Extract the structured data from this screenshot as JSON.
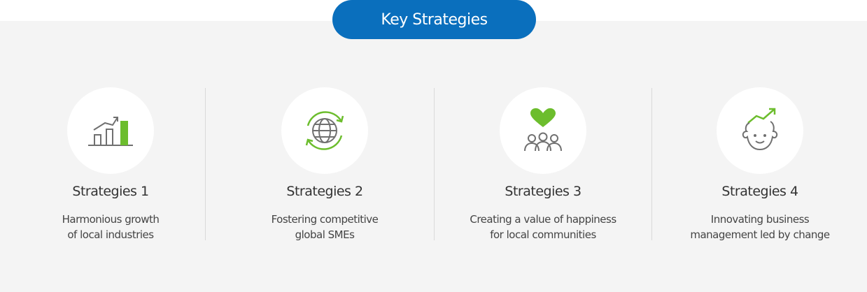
{
  "header": {
    "title": "Key Strategies"
  },
  "colors": {
    "accent_blue": "#0a6fbd",
    "accent_green": "#6cbd2d",
    "icon_gray": "#707070"
  },
  "strategies": [
    {
      "title": "Strategies 1",
      "desc": "Harmonious growth\nof local industries",
      "icon": "bar-chart-growth-icon"
    },
    {
      "title": "Strategies 2",
      "desc": "Fostering competitive\nglobal SMEs",
      "icon": "globe-cycle-icon"
    },
    {
      "title": "Strategies 3",
      "desc": "Creating a value of happiness\nfor local communities",
      "icon": "heart-people-icon"
    },
    {
      "title": "Strategies 4",
      "desc": "Innovating business\nmanagement led by change",
      "icon": "smiling-face-growth-icon"
    }
  ]
}
